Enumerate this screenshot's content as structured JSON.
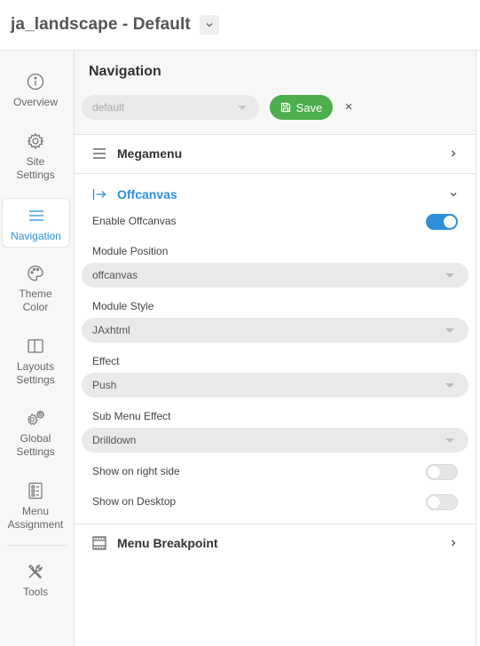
{
  "header": {
    "title": "ja_landscape - Default"
  },
  "sidebar": {
    "items": [
      {
        "label": "Overview",
        "icon": "info-icon"
      },
      {
        "label": "Site\nSettings",
        "icon": "gear-icon"
      },
      {
        "label": "Navigation",
        "icon": "menu-icon"
      },
      {
        "label": "Theme\nColor",
        "icon": "palette-icon"
      },
      {
        "label": "Layouts\nSettings",
        "icon": "layout-icon"
      },
      {
        "label": "Global\nSettings",
        "icon": "gears-icon"
      },
      {
        "label": "Menu\nAssignment",
        "icon": "assignment-icon"
      },
      {
        "label": "Tools",
        "icon": "tools-icon"
      }
    ],
    "active_index": 2
  },
  "main": {
    "title": "Navigation",
    "preset": {
      "value": "default"
    },
    "save_label": "Save",
    "close_glyph": "×",
    "sections": {
      "megamenu": {
        "label": "Megamenu"
      },
      "offcanvas": {
        "label": "Offcanvas",
        "enable_label": "Enable Offcanvas",
        "enable_on": true,
        "position_label": "Module Position",
        "position_value": "offcanvas",
        "style_label": "Module Style",
        "style_value": "JAxhtml",
        "effect_label": "Effect",
        "effect_value": "Push",
        "submenu_label": "Sub Menu Effect",
        "submenu_value": "Drilldown",
        "right_label": "Show on right side",
        "right_on": false,
        "desktop_label": "Show on Desktop",
        "desktop_on": false
      },
      "breakpoint": {
        "label": "Menu Breakpoint"
      }
    }
  },
  "colors": {
    "accent": "#2c8fd8",
    "save": "#4cae4c"
  }
}
